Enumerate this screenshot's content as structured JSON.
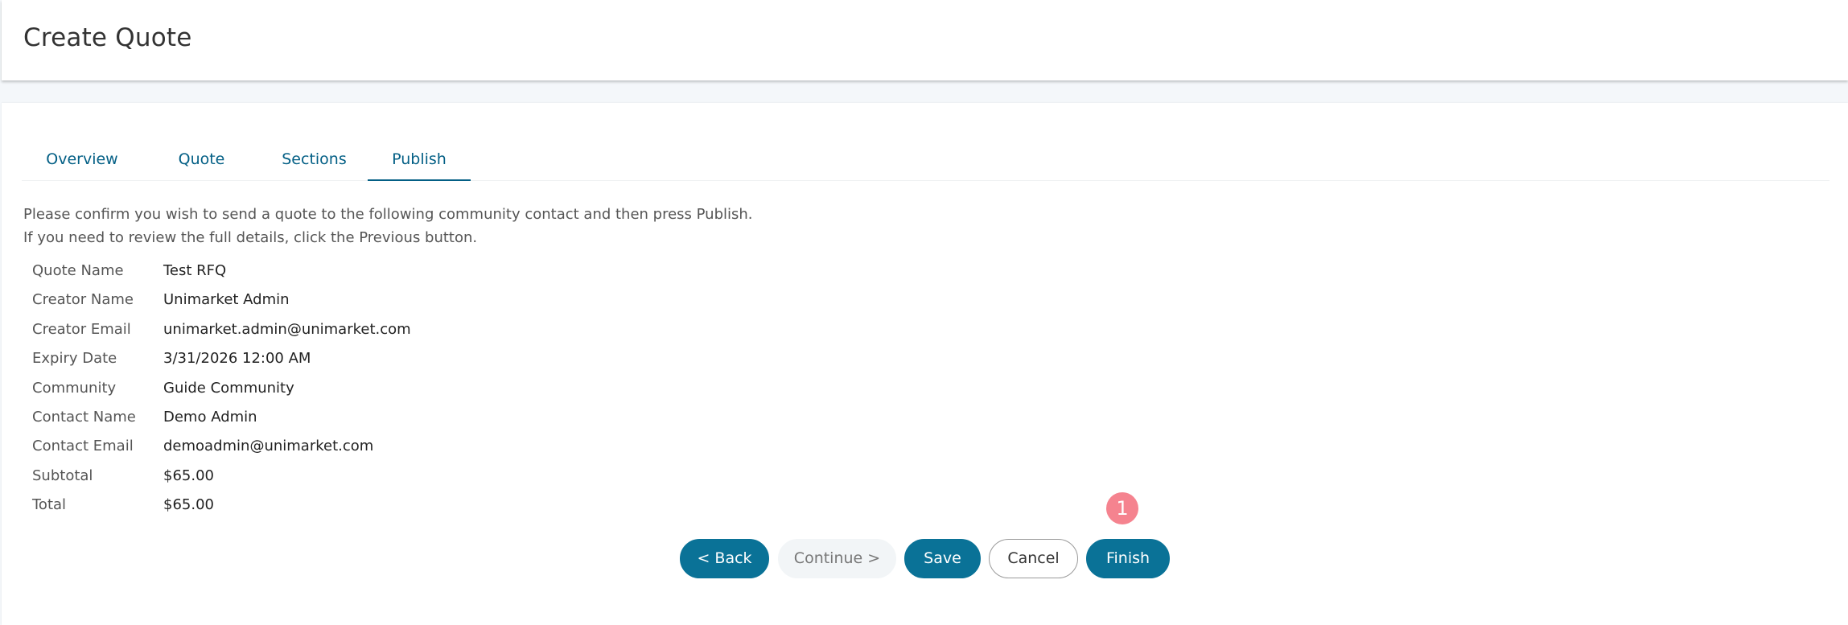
{
  "header": {
    "title": "Create Quote"
  },
  "tabs": [
    {
      "label": "Overview",
      "active": false
    },
    {
      "label": "Quote",
      "active": false
    },
    {
      "label": "Sections",
      "active": false
    },
    {
      "label": "Publish",
      "active": true
    }
  ],
  "intro": {
    "line1": "Please confirm you wish to send a quote to the following community contact and then press Publish.",
    "line2": "If you need to review the full details, click the Previous button."
  },
  "details": [
    {
      "label": "Quote Name",
      "value": "Test RFQ"
    },
    {
      "label": "Creator Name",
      "value": "Unimarket Admin"
    },
    {
      "label": "Creator Email",
      "value": "unimarket.admin@unimarket.com"
    },
    {
      "label": "Expiry Date",
      "value": "3/31/2026 12:00 AM"
    },
    {
      "label": "Community",
      "value": "Guide Community"
    },
    {
      "label": "Contact Name",
      "value": "Demo Admin"
    },
    {
      "label": "Contact Email",
      "value": "demoadmin@unimarket.com"
    },
    {
      "label": "Subtotal",
      "value": "$65.00"
    },
    {
      "label": "Total",
      "value": "$65.00"
    }
  ],
  "actions": {
    "back_label": "< Back",
    "continue_label": "Continue >",
    "save_label": "Save",
    "cancel_label": "Cancel",
    "finish_label": "Finish"
  },
  "step_badge": {
    "number": "1",
    "color": "#f5838f"
  },
  "colors": {
    "primary": "#0a7297",
    "tab_text": "#035f85",
    "badge": "#f5838f"
  }
}
